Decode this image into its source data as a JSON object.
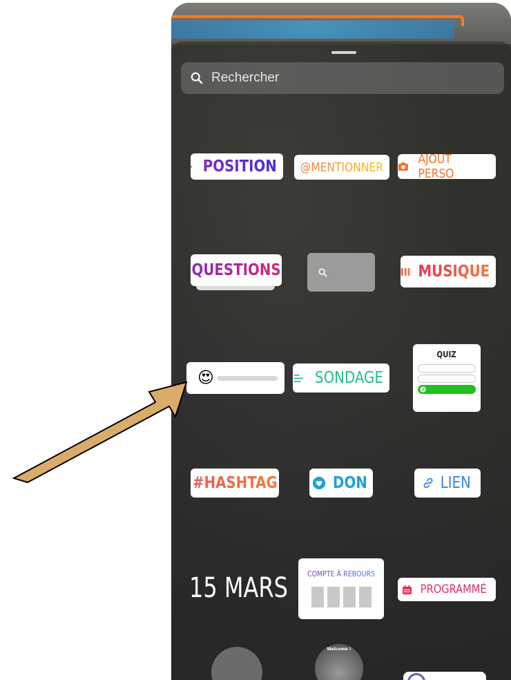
{
  "search": {
    "placeholder": "Rechercher"
  },
  "stickers": {
    "position": "POSITION",
    "mention": "@MENTIONNER",
    "ajout_perso": "AJOUT PERSO",
    "questions": "QUESTIONS",
    "musique": "MUSIQUE",
    "sondage": "SONDAGE",
    "quiz": "QUIZ",
    "hashtag": "#HASHTAG",
    "don": "DON",
    "lien": "LIEN",
    "date": "15 MARS",
    "compte_a_rebours": "COMPTE À REBOURS",
    "programme": "PROGRAMMÉ"
  },
  "bottom_row": {
    "welcome": "Welcome !"
  },
  "emoji": {
    "slider": "😍"
  },
  "colors": {
    "arrow_fill": "#d9ac6a",
    "arrow_stroke": "#000000",
    "position_purple": "#7b2fbe",
    "quiz_green": "#20c11d",
    "don_blue": "#1da1d9",
    "lien_blue": "#3486e8",
    "search_bg": "#7a7a7a"
  },
  "icons": {
    "search": "magnifier-icon",
    "position": "location-pin-icon",
    "ajout_perso": "camera-icon",
    "musique": "music-bars-icon",
    "sondage": "poll-lines-icon",
    "don": "heart-icon",
    "lien": "link-icon",
    "programme": "calendar-icon",
    "arrow": "pointer-arrow"
  }
}
